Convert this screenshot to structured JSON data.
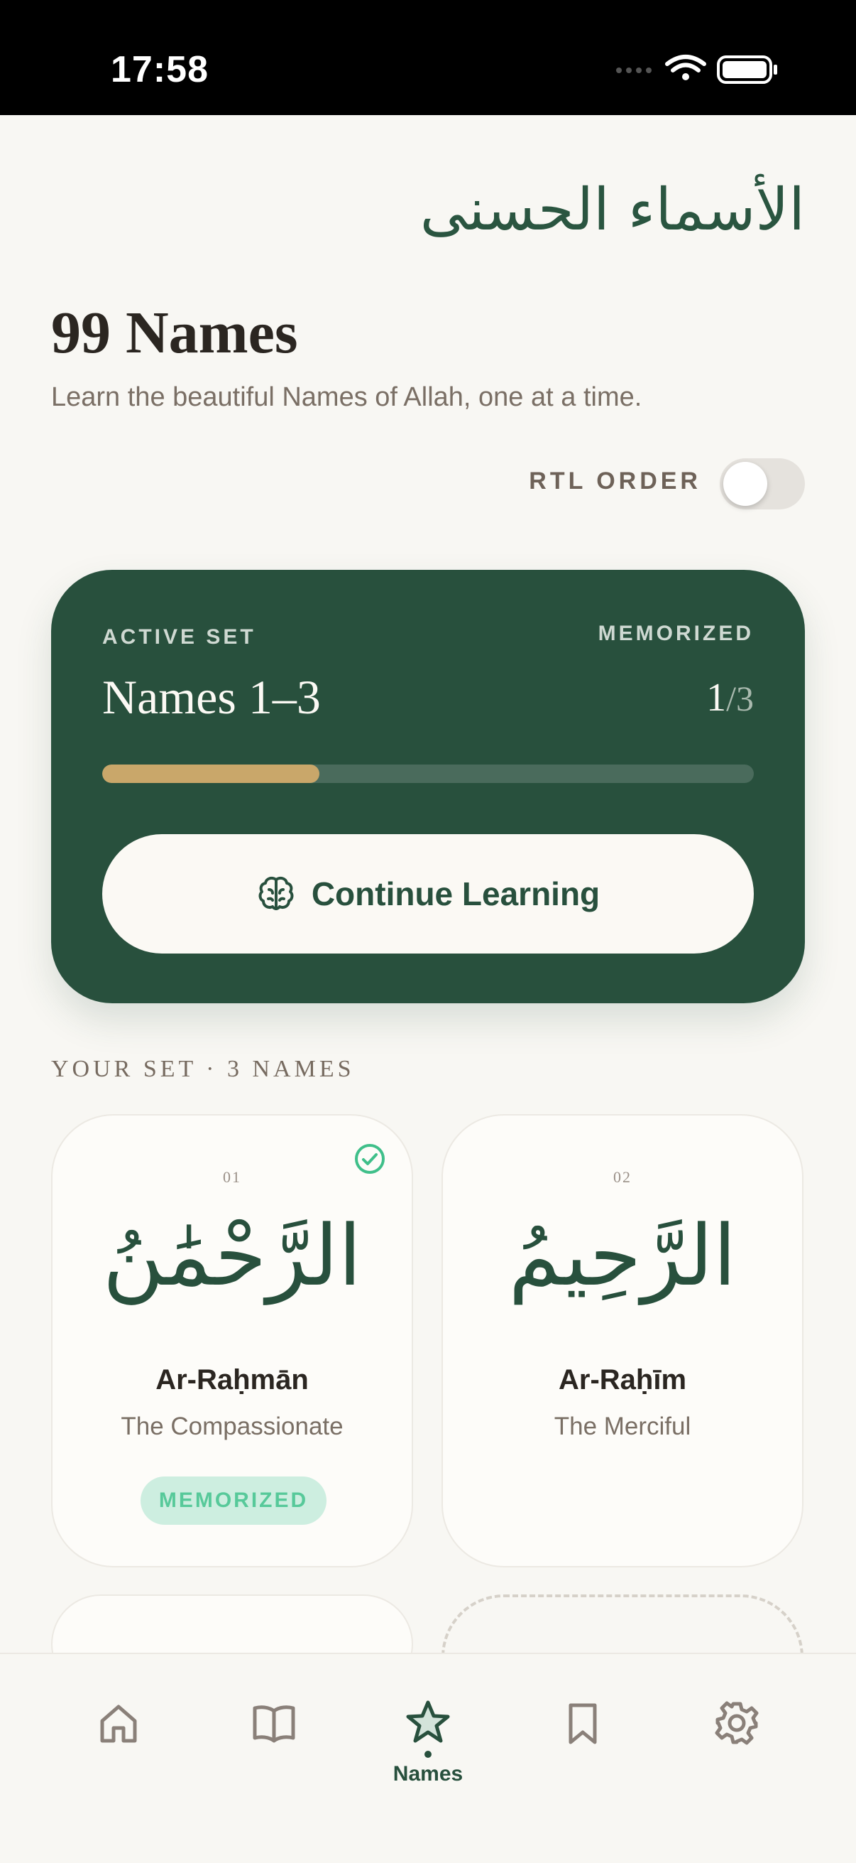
{
  "status_bar": {
    "time": "17:58"
  },
  "header": {
    "arabic_title": "الأسماء الحسنى",
    "title": "99 Names",
    "subtitle": "Learn the beautiful Names of Allah, one at a time.",
    "rtl_label": "RTL ORDER",
    "rtl_enabled": false
  },
  "active_set": {
    "label": "ACTIVE SET",
    "name": "Names 1–3",
    "memorized_label": "MEMORIZED",
    "memorized_count": "1",
    "memorized_total": "/3",
    "progress_fraction": 0.333,
    "button_label": "Continue Learning"
  },
  "section_label": "YOUR SET · 3 NAMES",
  "names": [
    {
      "number": "01",
      "arabic": "الرَّحْمَٰنُ",
      "translit": "Ar-Raḥmān",
      "meaning": "The Compassionate",
      "memorized": true,
      "badge": "MEMORIZED"
    },
    {
      "number": "02",
      "arabic": "الرَّحِيمُ",
      "translit": "Ar-Raḥīm",
      "meaning": "The Merciful",
      "memorized": false
    }
  ],
  "tabs": [
    {
      "icon": "home-icon",
      "active": false
    },
    {
      "icon": "book-icon",
      "active": false
    },
    {
      "icon": "star-icon",
      "label": "Names",
      "active": true
    },
    {
      "icon": "bookmark-icon",
      "active": false
    },
    {
      "icon": "gear-icon",
      "active": false
    }
  ],
  "colors": {
    "accent": "#28503d",
    "gold": "#c9a76a",
    "background": "#f8f7f3",
    "memorized": "#57c99a"
  }
}
